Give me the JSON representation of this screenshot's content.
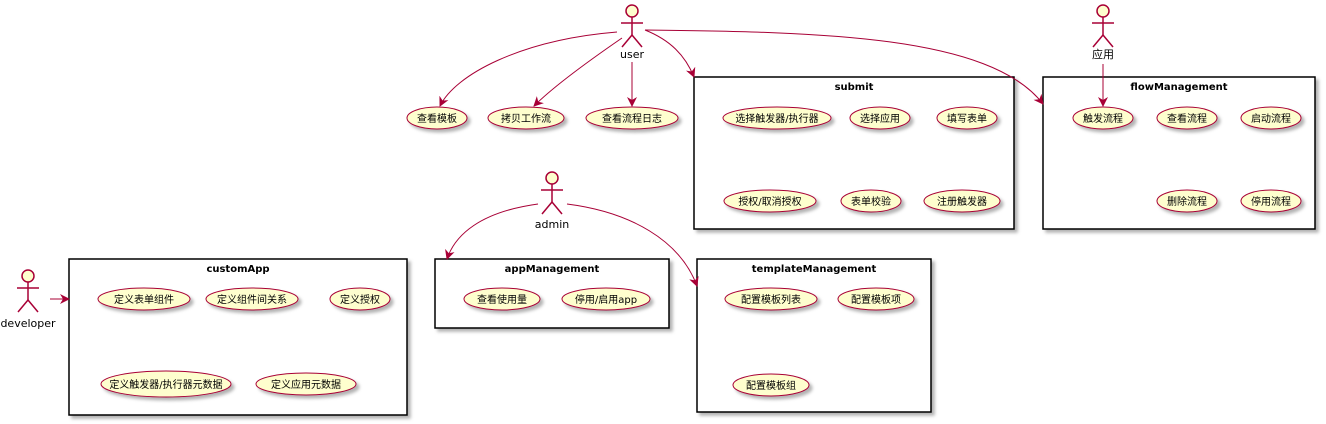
{
  "colors": {
    "arrow": "#A80036",
    "actor_fill": "#FEFECE",
    "usecase_fill": "#FEFECE",
    "usecase_border": "#A80036",
    "box_border": "#000000"
  },
  "actors": {
    "user": "user",
    "app": "应用",
    "admin": "admin",
    "developer": "developer"
  },
  "usecases": {
    "view_template": "查看模板",
    "copy_workflow": "拷贝工作流",
    "view_flow_log": "查看流程日志"
  },
  "packages": {
    "submit": {
      "title": "submit",
      "items": [
        "选择触发器/执行器",
        "选择应用",
        "填写表单",
        "授权/取消授权",
        "表单校验",
        "注册触发器"
      ]
    },
    "flowManagement": {
      "title": "flowManagement",
      "items": [
        "触发流程",
        "查看流程",
        "启动流程",
        "删除流程",
        "停用流程"
      ]
    },
    "customApp": {
      "title": "customApp",
      "items": [
        "定义表单组件",
        "定义组件间关系",
        "定义授权",
        "定义触发器/执行器元数据",
        "定义应用元数据"
      ]
    },
    "appManagement": {
      "title": "appManagement",
      "items": [
        "查看使用量",
        "停用/启用app"
      ]
    },
    "templateManagement": {
      "title": "templateManagement",
      "items": [
        "配置模板列表",
        "配置模板项",
        "配置模板组"
      ]
    }
  }
}
